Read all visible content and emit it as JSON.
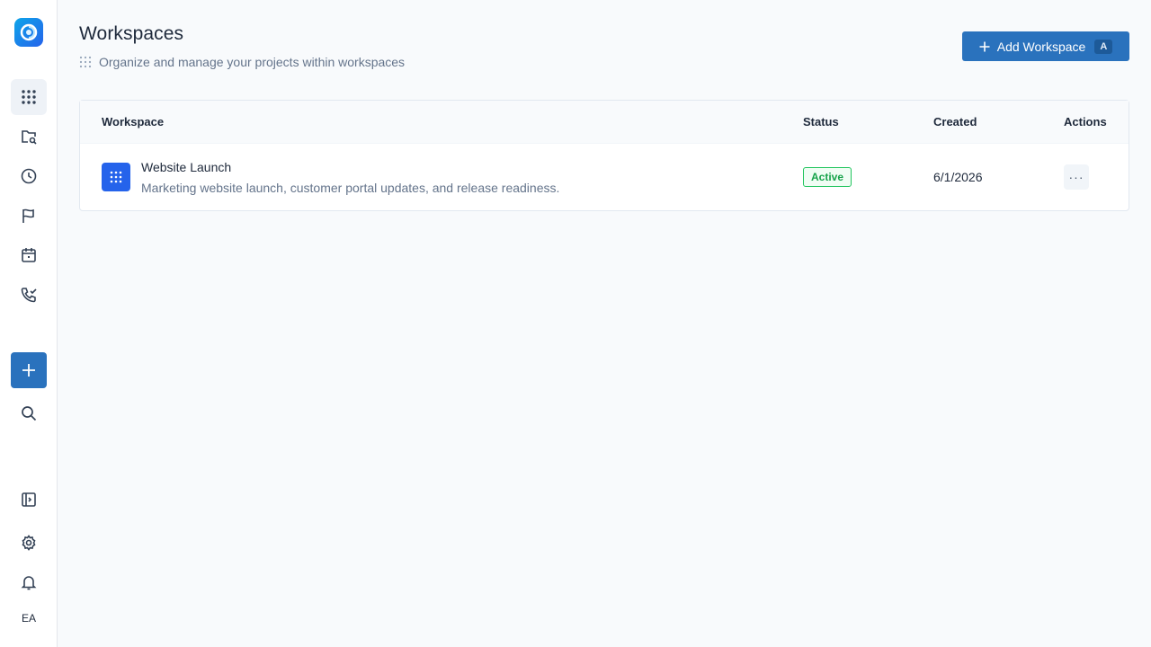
{
  "sidebar": {
    "items": [
      {
        "icon": "grid-icon",
        "active": true
      },
      {
        "icon": "folder-search-icon"
      },
      {
        "icon": "clock-icon"
      },
      {
        "icon": "flag-icon"
      },
      {
        "icon": "calendar-icon"
      },
      {
        "icon": "phone-check-icon"
      }
    ],
    "add_icon": "plus-icon",
    "search_icon": "search-icon",
    "panel_icon": "sidebar-panel-icon",
    "settings_icon": "gear-icon",
    "bell_icon": "bell-icon",
    "avatar_initials": "EA"
  },
  "header": {
    "title": "Workspaces",
    "subtitle": "Organize and manage your projects within workspaces",
    "add_button_label": "Add Workspace",
    "add_button_shortcut": "A"
  },
  "table": {
    "columns": [
      "Workspace",
      "Status",
      "Created",
      "Actions"
    ],
    "rows": [
      {
        "name": "Website Launch",
        "description": "Marketing website launch, customer portal updates, and release readiness.",
        "status": "Active",
        "created": "6/1/2026",
        "actions": "···"
      }
    ]
  },
  "colors": {
    "primary": "#2a72bd",
    "status_active": "#16a34a",
    "workspace_icon": "#2563eb"
  }
}
